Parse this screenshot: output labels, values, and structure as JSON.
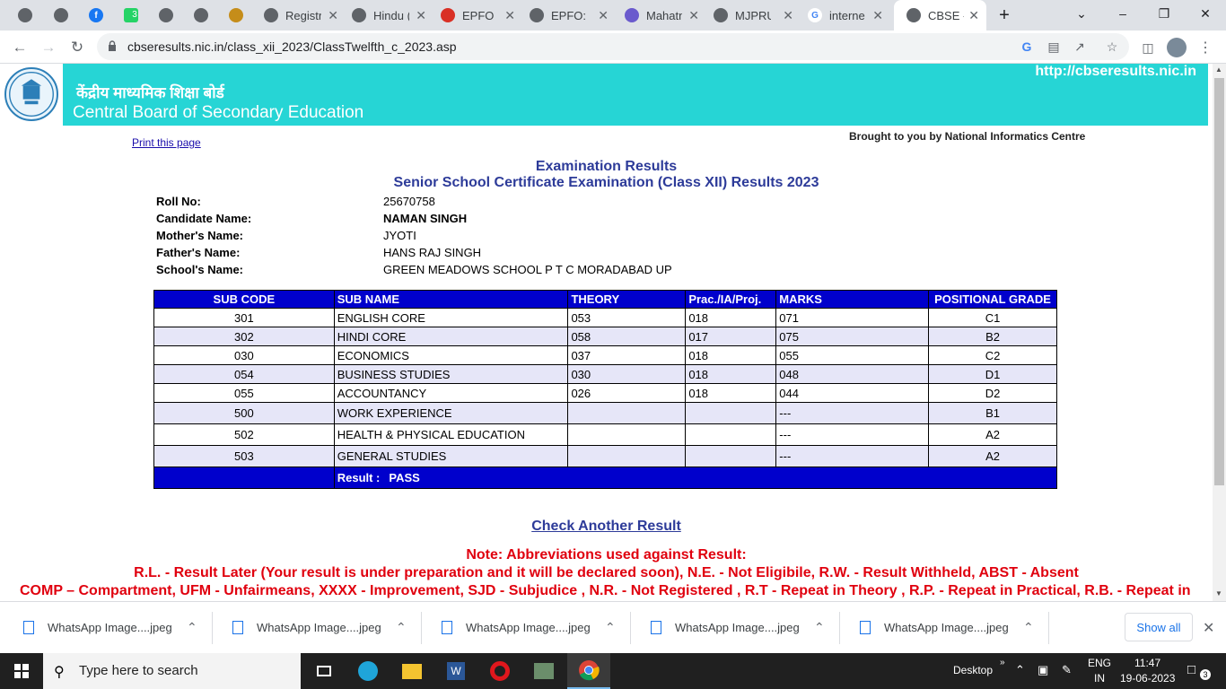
{
  "browser": {
    "tabs": [
      {
        "label": "",
        "favicon": "globe-icon"
      },
      {
        "label": "",
        "favicon": "globe-icon"
      },
      {
        "label": "",
        "favicon": "facebook-icon"
      },
      {
        "label": "",
        "favicon": "whatsapp-badge-icon",
        "badge": "3"
      },
      {
        "label": "",
        "favicon": "globe-icon"
      },
      {
        "label": "",
        "favicon": "globe-icon"
      },
      {
        "label": "",
        "favicon": "ita-icon"
      },
      {
        "label": "Registr",
        "favicon": "globe-icon"
      },
      {
        "label": "Hindu (",
        "favicon": "globe-icon"
      },
      {
        "label": "EPFO ||",
        "favicon": "epfo-icon"
      },
      {
        "label": "EPFO: H",
        "favicon": "globe-icon"
      },
      {
        "label": "Mahatm",
        "favicon": "university-icon"
      },
      {
        "label": "MJPRU",
        "favicon": "globe-icon"
      },
      {
        "label": "interne",
        "favicon": "google-icon"
      },
      {
        "label": "CBSE -",
        "favicon": "globe-icon",
        "active": true
      }
    ],
    "url": "cbseresults.nic.in/class_xii_2023/ClassTwelfth_c_2023.asp"
  },
  "banner": {
    "hindi_title": "केंद्रीय माध्यमिक शिक्षा बोर्ड",
    "english_title": "Central Board of Secondary Education",
    "site_url": "http://cbseresults.nic.in"
  },
  "page": {
    "print_link": "Print this page",
    "nic_credit": "Brought to you by National Informatics Centre",
    "heading1": "Examination Results",
    "heading2": "Senior School Certificate Examination (Class XII) Results 2023"
  },
  "candidate": {
    "roll_label": "Roll No:",
    "roll": "25670758",
    "name_label": "Candidate Name:",
    "name": "NAMAN SINGH",
    "mother_label": "Mother's Name:",
    "mother": "JYOTI",
    "father_label": "Father's Name:",
    "father": "HANS RAJ SINGH",
    "school_label": "School's Name:",
    "school": "GREEN MEADOWS SCHOOL P T C MORADABAD UP"
  },
  "results_table": {
    "headers": [
      "SUB CODE",
      "SUB NAME",
      "THEORY",
      "Prac./IA/Proj.",
      "MARKS",
      "POSITIONAL GRADE"
    ],
    "rows": [
      {
        "code": "301",
        "name": "ENGLISH CORE",
        "theory": "053",
        "prac": "018",
        "marks": "071",
        "grade": "C1"
      },
      {
        "code": "302",
        "name": "HINDI CORE",
        "theory": "058",
        "prac": "017",
        "marks": "075",
        "grade": "B2"
      },
      {
        "code": "030",
        "name": "ECONOMICS",
        "theory": "037",
        "prac": "018",
        "marks": "055",
        "grade": "C2"
      },
      {
        "code": "054",
        "name": "BUSINESS STUDIES",
        "theory": "030",
        "prac": "018",
        "marks": "048",
        "grade": "D1"
      },
      {
        "code": "055",
        "name": "ACCOUNTANCY",
        "theory": "026",
        "prac": "018",
        "marks": "044",
        "grade": "D2"
      },
      {
        "code": "500",
        "name": "WORK EXPERIENCE",
        "theory": "",
        "prac": "",
        "marks": "---",
        "grade": "B1"
      },
      {
        "code": "502",
        "name": "HEALTH & PHYSICAL EDUCATION",
        "theory": "",
        "prac": "",
        "marks": "---",
        "grade": "A2"
      },
      {
        "code": "503",
        "name": "GENERAL STUDIES",
        "theory": "",
        "prac": "",
        "marks": "---",
        "grade": "A2"
      }
    ],
    "result_label": "Result :",
    "result_value": "PASS"
  },
  "check_another": "Check Another Result",
  "notes": {
    "title": "Note: Abbreviations used against Result:",
    "line1": "R.L. - Result Later (Your result is under preparation and it will be declared soon), N.E. - Not Eligibile, R.W. - Result Withheld, ABST - Absent",
    "line2": "COMP – Compartment, UFM - Unfairmeans, XXXX - Improvement, SJD - Subjudice , N.R. - Not Registered , R.T - Repeat in Theory , R.P. - Repeat in Practical, R.B. - Repeat in"
  },
  "downloads": {
    "items": [
      "WhatsApp Image....jpeg",
      "WhatsApp Image....jpeg",
      "WhatsApp Image....jpeg",
      "WhatsApp Image....jpeg",
      "WhatsApp Image....jpeg"
    ],
    "show_all": "Show all"
  },
  "taskbar": {
    "search_placeholder": "Type here to search",
    "desktop_label": "Desktop",
    "lang1": "ENG",
    "lang2": "IN",
    "time": "11:47",
    "date": "19-06-2023",
    "notif_count": "3"
  }
}
